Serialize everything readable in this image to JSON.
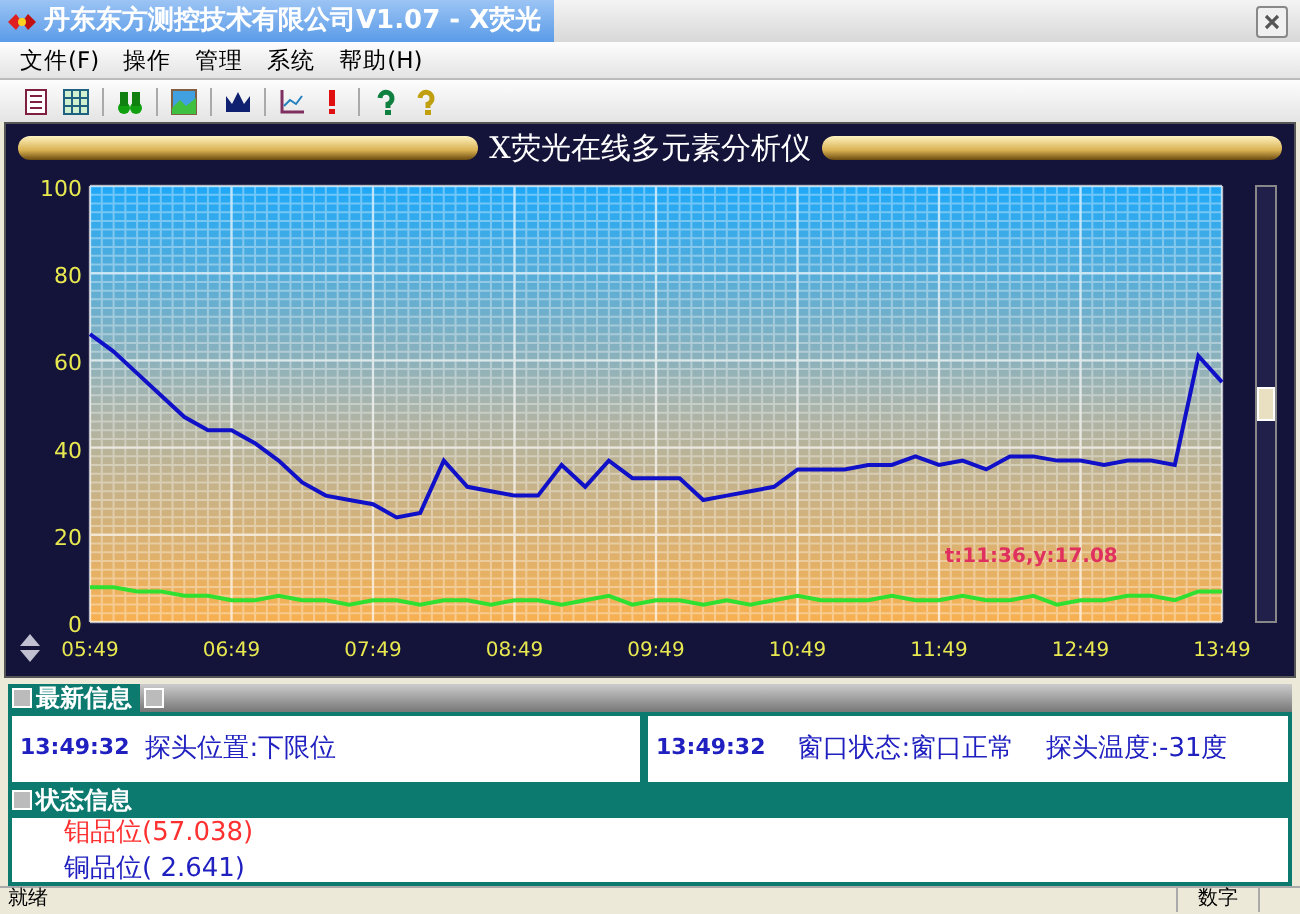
{
  "window": {
    "title": "丹东东方测控技术有限公司V1.07 - X荧光"
  },
  "menu": [
    {
      "label": "文件(F)"
    },
    {
      "label": "操作"
    },
    {
      "label": "管理"
    },
    {
      "label": "系统"
    },
    {
      "label": "帮助(H)"
    }
  ],
  "panel_title": "X荧光在线多元素分析仪",
  "chart": {
    "chart_data": {
      "type": "line",
      "categories": [
        "05:49",
        null,
        null,
        null,
        null,
        null,
        "06:49",
        null,
        null,
        null,
        null,
        null,
        "07:49",
        null,
        null,
        null,
        null,
        null,
        "08:49",
        null,
        null,
        null,
        null,
        null,
        "09:49",
        null,
        null,
        null,
        null,
        null,
        "10:49",
        null,
        null,
        null,
        null,
        null,
        "11:49",
        null,
        null,
        null,
        null,
        null,
        "12:49",
        null,
        null,
        null,
        null,
        null,
        "13:49"
      ],
      "series": [
        {
          "color": "#1010c8",
          "values": [
            66,
            62,
            57,
            52,
            47,
            44,
            44,
            41,
            37,
            32,
            29,
            28,
            27,
            24,
            25,
            37,
            31,
            30,
            29,
            29,
            36,
            31,
            37,
            33,
            33,
            33,
            28,
            29,
            30,
            31,
            35,
            35,
            35,
            36,
            36,
            38,
            36,
            37,
            35,
            38,
            38,
            37,
            37,
            36,
            37,
            37,
            36,
            61,
            55
          ]
        },
        {
          "color": "#30e030",
          "values": [
            8,
            8,
            7,
            7,
            6,
            6,
            5,
            5,
            6,
            5,
            5,
            4,
            5,
            5,
            4,
            5,
            5,
            4,
            5,
            5,
            4,
            5,
            6,
            4,
            5,
            5,
            4,
            5,
            4,
            5,
            6,
            5,
            5,
            5,
            6,
            5,
            5,
            6,
            5,
            5,
            6,
            4,
            5,
            5,
            6,
            6,
            5,
            7,
            7
          ]
        }
      ],
      "ylim": [
        0,
        100
      ],
      "grid": true,
      "yticks": [
        0,
        20,
        40,
        60,
        80,
        100
      ],
      "annotations": [
        "t:11:36,y:17.08"
      ]
    }
  },
  "latest_info": {
    "title": "最新信息",
    "left": {
      "time": "13:49:32",
      "message": "探头位置:下限位"
    },
    "right": {
      "time": "13:49:32",
      "items": [
        "窗口状态:窗口正常",
        "探头温度:-31度"
      ]
    }
  },
  "status_info": {
    "title": "状态信息",
    "lines": [
      {
        "text": "钼品位(57.038)",
        "color": "#ff3030"
      },
      {
        "text": "铜品位( 2.641)",
        "color": "#2020c0"
      }
    ]
  },
  "status_bar": [
    "就绪",
    "数字"
  ]
}
